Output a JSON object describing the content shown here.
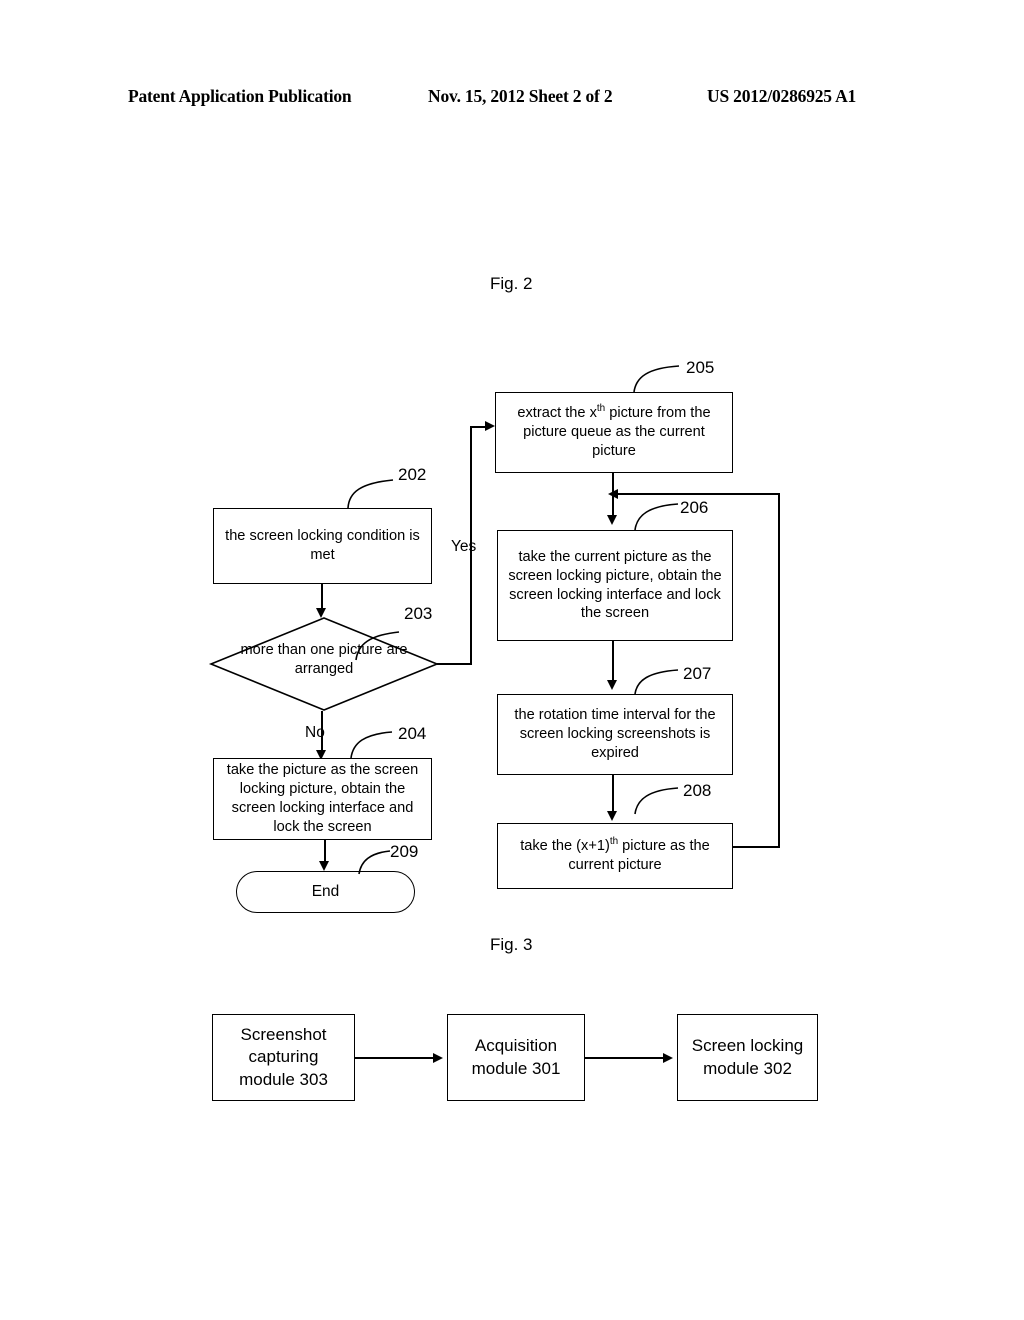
{
  "header": {
    "left": "Patent Application Publication",
    "middle": "Nov. 15, 2012  Sheet 2 of 2",
    "right": "US 2012/0286925 A1"
  },
  "figures": [
    {
      "id": "fig2",
      "caption": "Fig. 2"
    },
    {
      "id": "fig3",
      "caption": "Fig. 3"
    }
  ],
  "fig2": {
    "caption": "Fig. 2",
    "nodes": {
      "n202": {
        "ref": "202",
        "text": "the screen locking condition is met",
        "shape": "process"
      },
      "n203": {
        "ref": "203",
        "text": "more than one picture are arranged",
        "shape": "decision"
      },
      "n204": {
        "ref": "204",
        "text": "take the picture as the screen locking picture, obtain the screen locking interface and lock the screen",
        "shape": "process"
      },
      "n205": {
        "ref": "205",
        "text_pre": "extract the x",
        "text_sup": "th",
        "text_post": " picture from the picture queue as the current picture",
        "shape": "process"
      },
      "n206": {
        "ref": "206",
        "text": "take the current picture as the screen locking picture, obtain the screen locking interface and lock the screen",
        "shape": "process"
      },
      "n207": {
        "ref": "207",
        "text": "the rotation time interval for the screen locking screenshots is expired",
        "shape": "process"
      },
      "n208": {
        "ref": "208",
        "text_pre": "take the (x+1)",
        "text_sup": "th",
        "text_post": " picture as the current picture",
        "shape": "process"
      },
      "n209": {
        "ref": "209",
        "text": "End",
        "shape": "terminator"
      }
    },
    "branch_labels": {
      "yes": "Yes",
      "no": "No"
    }
  },
  "fig3": {
    "caption": "Fig. 3",
    "nodes": [
      {
        "id": "m303",
        "text": "Screenshot capturing module 303"
      },
      {
        "id": "m301",
        "text": "Acquisition module 301"
      },
      {
        "id": "m302",
        "text": "Screen locking module 302"
      }
    ]
  },
  "colors": {
    "ink": "#000000",
    "paper": "#ffffff"
  }
}
